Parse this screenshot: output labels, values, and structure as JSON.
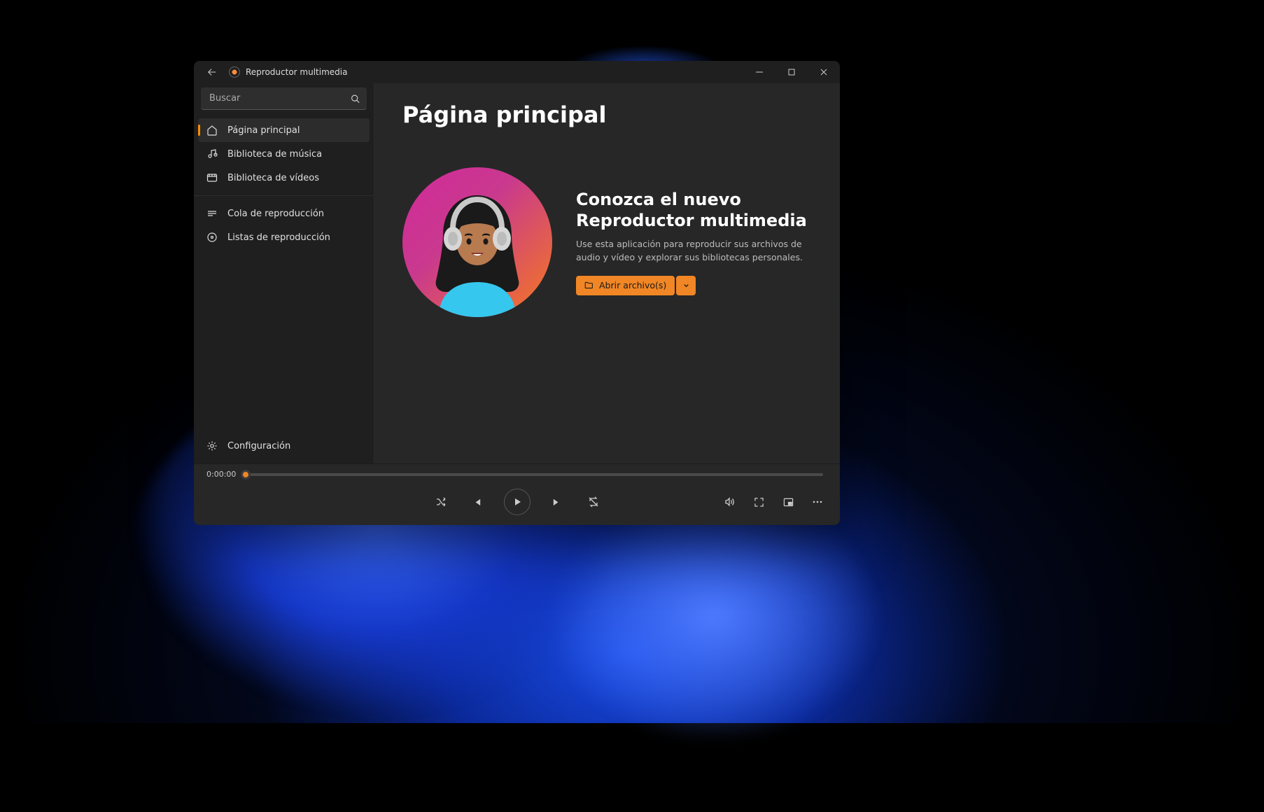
{
  "app": {
    "title": "Reproductor multimedia"
  },
  "search": {
    "placeholder": "Buscar"
  },
  "sidebar": {
    "nav": [
      {
        "label": "Página principal"
      },
      {
        "label": "Biblioteca de música"
      },
      {
        "label": "Biblioteca de vídeos"
      }
    ],
    "secondary": [
      {
        "label": "Cola de reproducción"
      },
      {
        "label": "Listas de reproducción"
      }
    ],
    "settings_label": "Configuración"
  },
  "page": {
    "title": "Página principal",
    "hero_title": "Conozca el nuevo Reproductor multimedia",
    "hero_desc": "Use esta aplicación para reproducir sus archivos de audio y vídeo y explorar sus bibliotecas personales.",
    "open_label": "Abrir archivo(s)"
  },
  "player": {
    "current_time": "0:00:00"
  },
  "colors": {
    "accent": "#f08625"
  }
}
